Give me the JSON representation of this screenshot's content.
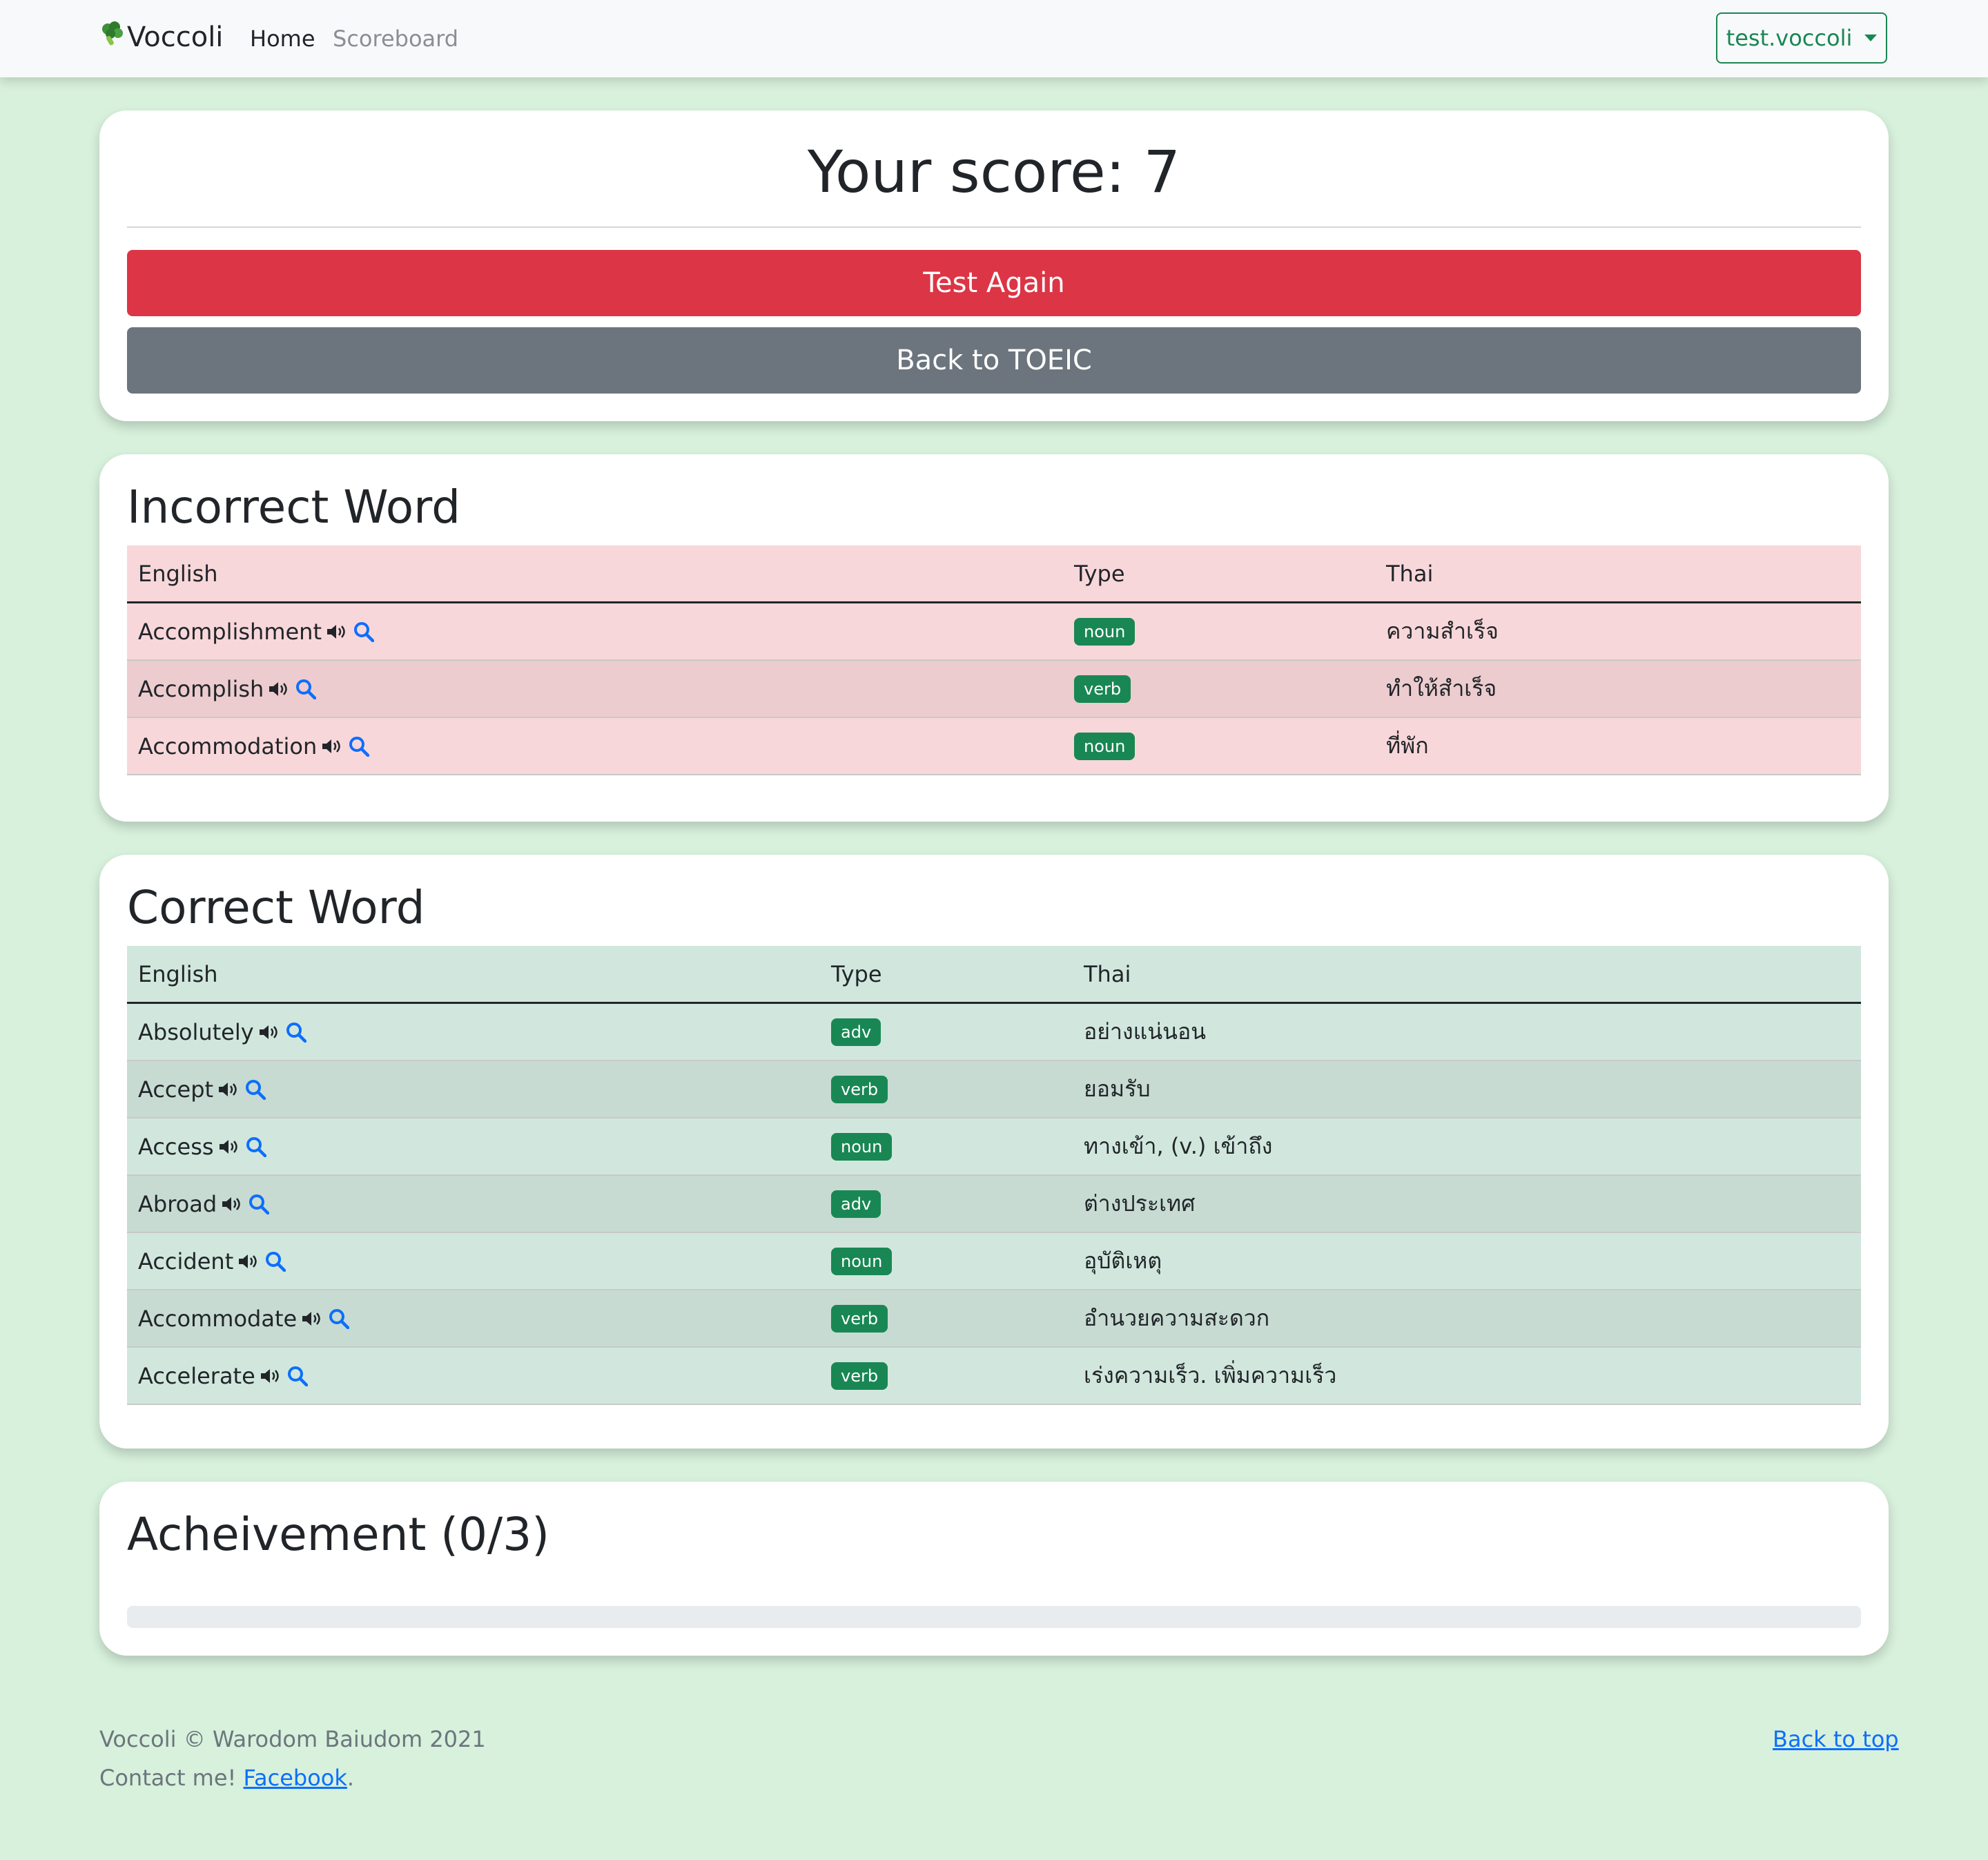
{
  "navbar": {
    "brand": "Voccoli",
    "brand_icon": "broccoli-icon",
    "links": [
      "Home",
      "Scoreboard"
    ],
    "user": "test.voccoli"
  },
  "score": {
    "title": "Your score: 7",
    "test_again": "Test Again",
    "back": "Back to TOEIC"
  },
  "incorrect": {
    "title": "Incorrect Word",
    "headers": [
      "English",
      "Type",
      "Thai"
    ],
    "rows": [
      {
        "english": "Accomplishment",
        "type": "noun",
        "thai": "ความสำเร็จ"
      },
      {
        "english": "Accomplish",
        "type": "verb",
        "thai": "ทำให้สำเร็จ"
      },
      {
        "english": "Accommodation",
        "type": "noun",
        "thai": "ที่พัก"
      }
    ]
  },
  "correct": {
    "title": "Correct Word",
    "headers": [
      "English",
      "Type",
      "Thai"
    ],
    "rows": [
      {
        "english": "Absolutely",
        "type": "adv",
        "thai": "อย่างแน่นอน"
      },
      {
        "english": "Accept",
        "type": "verb",
        "thai": "ยอมรับ"
      },
      {
        "english": "Access",
        "type": "noun",
        "thai": "ทางเข้า, (v.) เข้าถึง"
      },
      {
        "english": "Abroad",
        "type": "adv",
        "thai": "ต่างประเทศ"
      },
      {
        "english": "Accident",
        "type": "noun",
        "thai": "อุบัติเหตุ"
      },
      {
        "english": "Accommodate",
        "type": "verb",
        "thai": "อำนวยความสะดวก"
      },
      {
        "english": "Accelerate",
        "type": "verb",
        "thai": "เร่งความเร็ว. เพิ่มความเร็ว"
      }
    ]
  },
  "achievement": {
    "title": "Acheivement (0/3)",
    "progress_percent": 0
  },
  "footer": {
    "copyright": "Voccoli © Warodom Baiudom 2021",
    "contact_prefix": "Contact me!",
    "contact_link": "Facebook",
    "contact_suffix": ".",
    "back_to_top": "Back to top"
  },
  "colors": {
    "accent_green": "#198754",
    "danger": "#dc3545",
    "secondary": "#6c757d",
    "page_bg": "#d7f1dc"
  }
}
